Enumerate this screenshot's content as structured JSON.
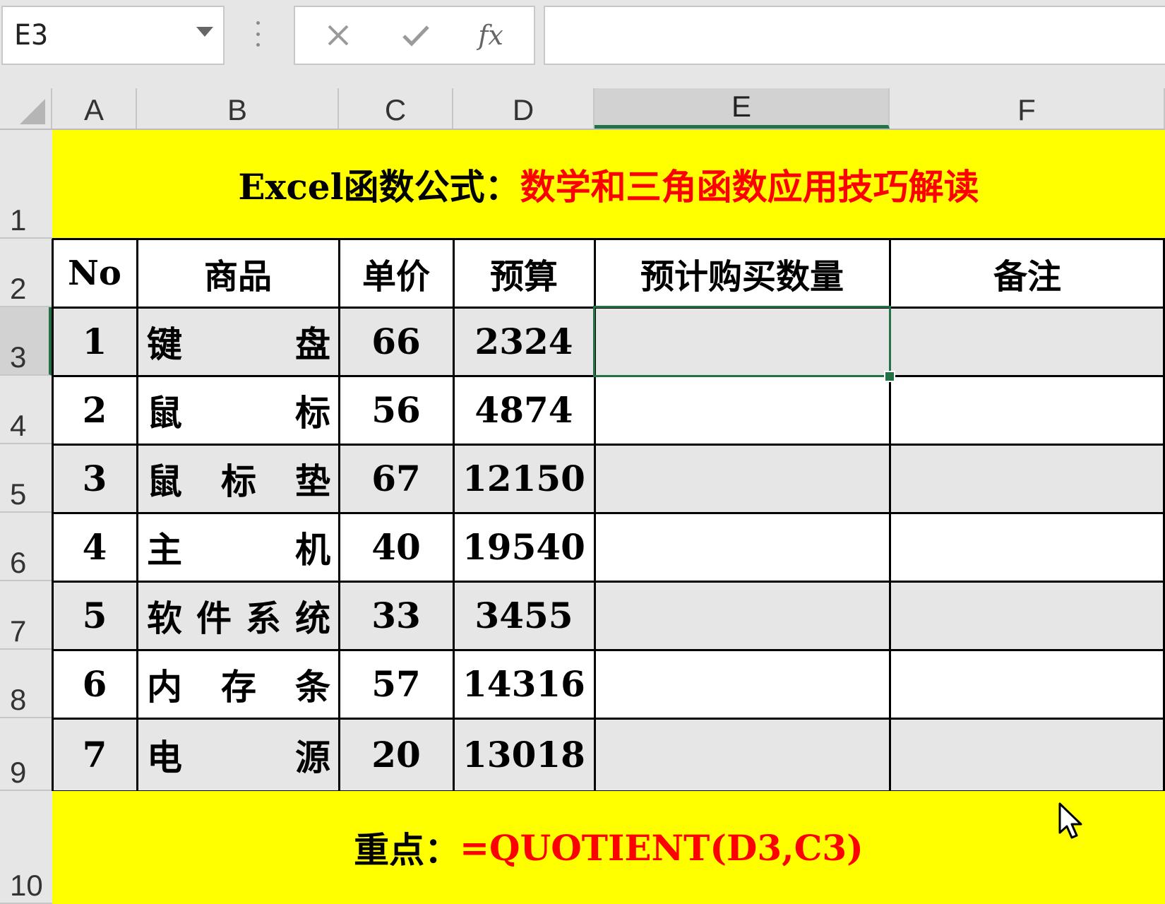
{
  "formula_bar": {
    "name_box": "E3",
    "cancel_icon": "close-icon",
    "confirm_icon": "check-icon",
    "fx_label": "fx",
    "formula_value": ""
  },
  "columns": [
    "A",
    "B",
    "C",
    "D",
    "E",
    "F"
  ],
  "selected_column": "E",
  "rows": [
    "1",
    "2",
    "3",
    "4",
    "5",
    "6",
    "7",
    "8",
    "9",
    "10"
  ],
  "selected_row": "3",
  "title": {
    "black_part": "Excel函数公式：",
    "red_part": "数学和三角函数应用技巧解读"
  },
  "table": {
    "headers": [
      "No",
      "商品",
      "单价",
      "预算",
      "预计购买数量",
      "备注"
    ],
    "rows": [
      {
        "no": "1",
        "product": [
          "键",
          "盘"
        ],
        "price": "66",
        "budget": "2324",
        "qty": "",
        "note": ""
      },
      {
        "no": "2",
        "product": [
          "鼠",
          "标"
        ],
        "price": "56",
        "budget": "4874",
        "qty": "",
        "note": ""
      },
      {
        "no": "3",
        "product": [
          "鼠",
          "标",
          "垫"
        ],
        "price": "67",
        "budget": "12150",
        "qty": "",
        "note": ""
      },
      {
        "no": "4",
        "product": [
          "主",
          "机"
        ],
        "price": "40",
        "budget": "19540",
        "qty": "",
        "note": ""
      },
      {
        "no": "5",
        "product": [
          "软",
          "件",
          "系",
          "统"
        ],
        "price": "33",
        "budget": "3455",
        "qty": "",
        "note": ""
      },
      {
        "no": "6",
        "product": [
          "内",
          "存",
          "条"
        ],
        "price": "57",
        "budget": "14316",
        "qty": "",
        "note": ""
      },
      {
        "no": "7",
        "product": [
          "电",
          "源"
        ],
        "price": "20",
        "budget": "13018",
        "qty": "",
        "note": ""
      }
    ]
  },
  "footer": {
    "black_part": "重点：",
    "red_part": "=QUOTIENT(D3,C3)"
  },
  "colors": {
    "highlight": "#ffff00",
    "accent_red": "#ff0000",
    "selection_green": "#217346",
    "band_gray": "#e6e6e6"
  }
}
